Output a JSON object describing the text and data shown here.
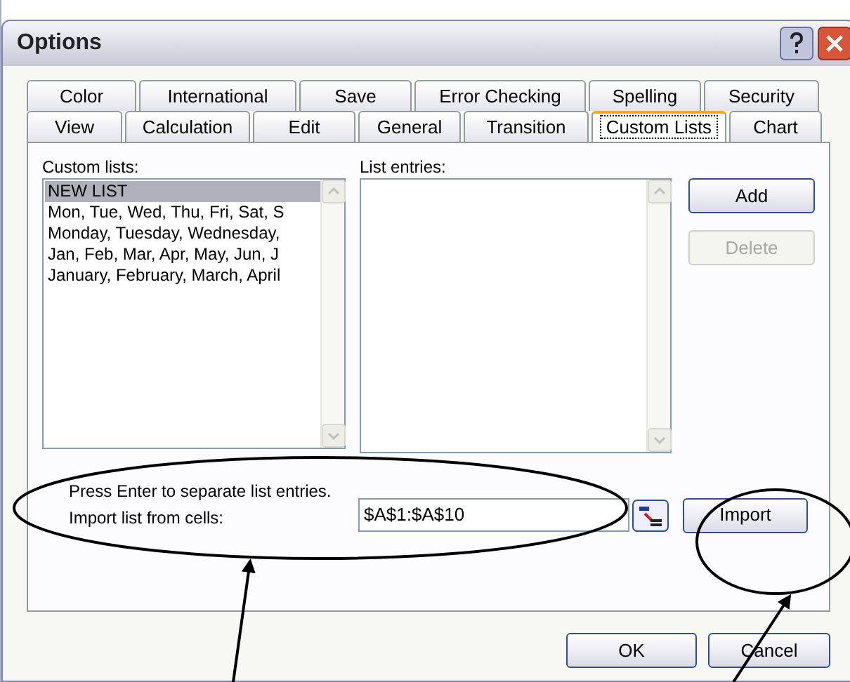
{
  "window": {
    "title": "Options"
  },
  "tab_rows": [
    [
      {
        "label": "Color",
        "selected": false
      },
      {
        "label": "International",
        "selected": false
      },
      {
        "label": "Save",
        "selected": false
      },
      {
        "label": "Error Checking",
        "selected": false
      },
      {
        "label": "Spelling",
        "selected": false
      },
      {
        "label": "Security",
        "selected": false
      }
    ],
    [
      {
        "label": "View",
        "selected": false
      },
      {
        "label": "Calculation",
        "selected": false
      },
      {
        "label": "Edit",
        "selected": false
      },
      {
        "label": "General",
        "selected": false
      },
      {
        "label": "Transition",
        "selected": false
      },
      {
        "label": "Custom Lists",
        "selected": true
      },
      {
        "label": "Chart",
        "selected": false
      }
    ]
  ],
  "custom_lists": {
    "label": "Custom lists:",
    "items": [
      {
        "text": "NEW LIST",
        "selected": true
      },
      {
        "text": "Mon, Tue, Wed, Thu, Fri, Sat, S",
        "selected": false
      },
      {
        "text": "Monday, Tuesday, Wednesday,",
        "selected": false
      },
      {
        "text": "Jan, Feb, Mar, Apr, May, Jun, J",
        "selected": false
      },
      {
        "text": "January, February, March, April",
        "selected": false
      }
    ]
  },
  "list_entries": {
    "label": "List entries:"
  },
  "side_buttons": [
    {
      "label": "Add",
      "disabled": false
    },
    {
      "label": "Delete",
      "disabled": true
    }
  ],
  "hint": "Press Enter to separate list entries.",
  "import": {
    "label": "Import list from cells:",
    "value": "$A$1:$A$10",
    "button": "Import"
  },
  "footer_buttons": [
    "OK",
    "Cancel"
  ]
}
